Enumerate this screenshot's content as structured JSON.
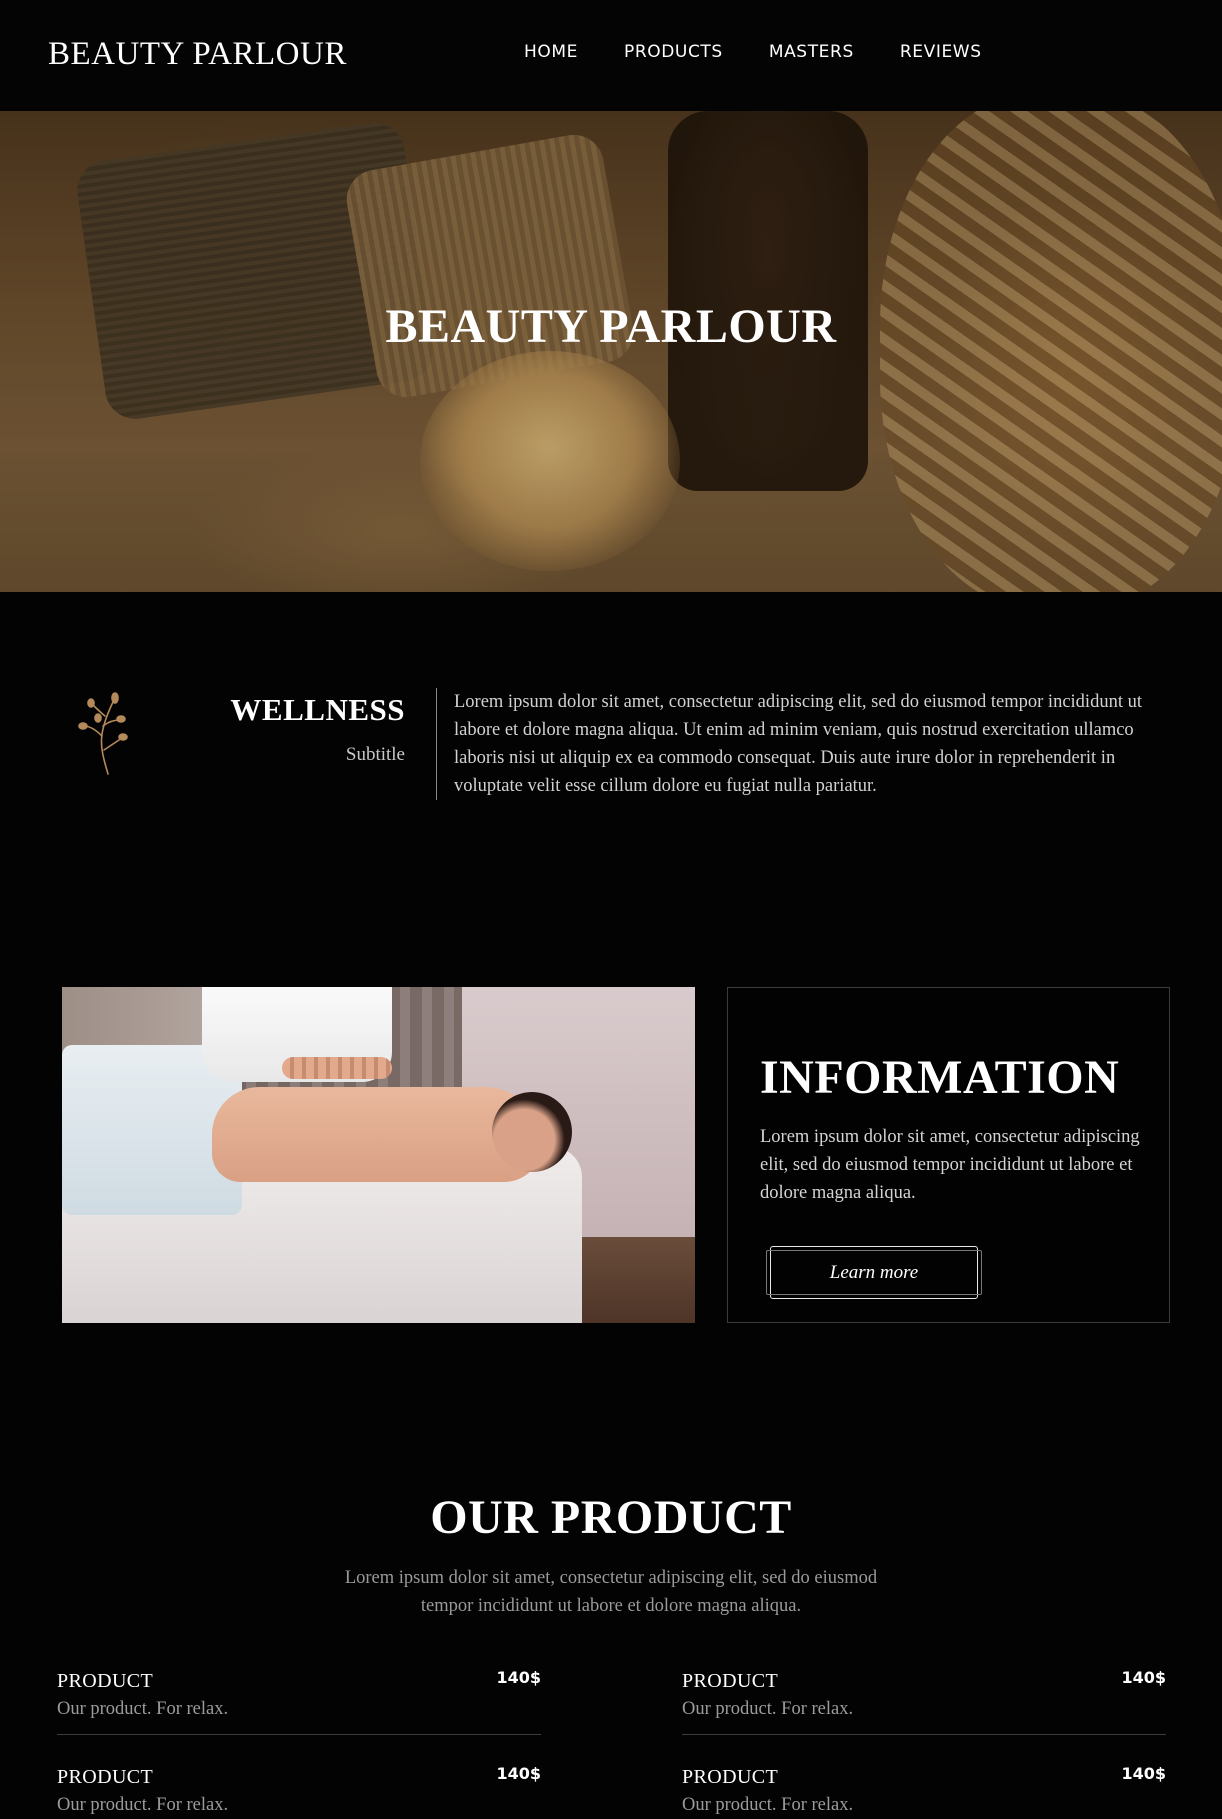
{
  "nav": {
    "logo": "BEAUTY PARLOUR",
    "items": [
      {
        "label": "HOME"
      },
      {
        "label": "PRODUCTS"
      },
      {
        "label": "MASTERS"
      },
      {
        "label": "REVIEWS"
      }
    ]
  },
  "hero": {
    "title": "BEAUTY PARLOUR"
  },
  "wellness": {
    "icon": "leaf-branch-icon",
    "title": "WELLNESS",
    "subtitle": "Subtitle",
    "text": "Lorem ipsum dolor sit amet, consectetur adipiscing elit, sed do eiusmod tempor incididunt ut labore et dolore magna aliqua. Ut enim ad minim veniam, quis nostrud exercitation ullamco laboris nisi ut aliquip ex ea commodo consequat. Duis aute irure dolor in reprehenderit in voluptate velit esse cillum dolore eu fugiat nulla pariatur."
  },
  "information": {
    "title": "INFORMATION",
    "text": "Lorem ipsum dolor sit amet, consectetur adipiscing elit, sed do eiusmod tempor incididunt ut labore et dolore magna aliqua.",
    "button_label": "Learn more"
  },
  "products": {
    "title": "OUR PRODUCT",
    "subtitle": "Lorem ipsum dolor sit amet, consectetur adipiscing elit, sed do eiusmod tempor incididunt ut labore et dolore magna aliqua.",
    "items": [
      {
        "name": "PRODUCT",
        "price": "140$",
        "desc": "Our product. For relax."
      },
      {
        "name": "PRODUCT",
        "price": "140$",
        "desc": "Our product. For relax."
      },
      {
        "name": "PRODUCT",
        "price": "140$",
        "desc": "Our product. For relax."
      },
      {
        "name": "PRODUCT",
        "price": "140$",
        "desc": "Our product. For relax."
      }
    ]
  },
  "colors": {
    "background": "#030303",
    "text": "#ffffff",
    "muted_text": "#9a9a9a",
    "accent_gold": "#b48a5a"
  }
}
